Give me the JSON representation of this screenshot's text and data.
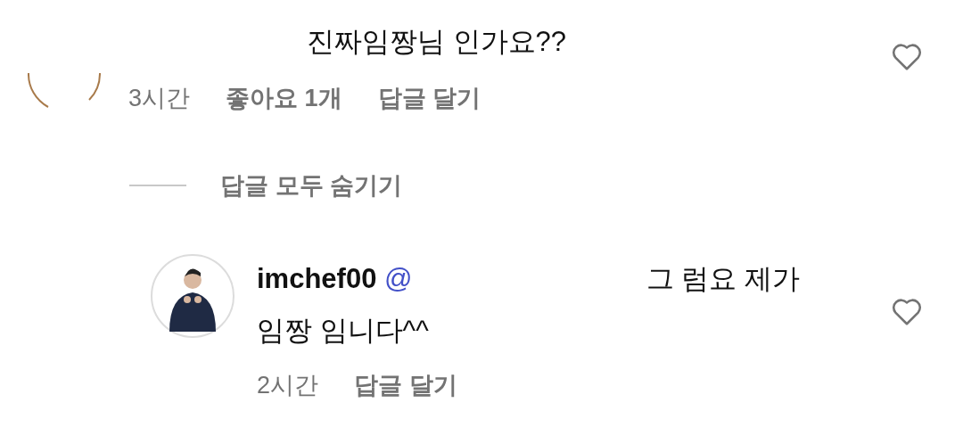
{
  "comments": [
    {
      "text": "진짜임짱님 인가요??",
      "time": "3시간",
      "likes": "좋아요 1개",
      "reply_label": "답글 달기",
      "liked": false,
      "kind": "faded",
      "replies_toggle": "답글 모두 숨기기",
      "replies": [
        {
          "username": "imchef00",
          "mention": "@",
          "text": "그 럼요 제가 임짱 임니다^^",
          "time": "2시간",
          "reply_label": "답글 달기",
          "liked": false,
          "kind": "person"
        }
      ]
    }
  ]
}
